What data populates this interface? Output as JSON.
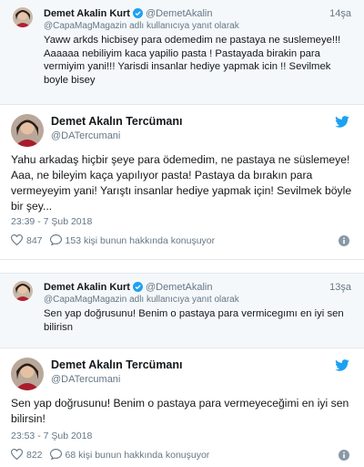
{
  "reply1": {
    "name": "Demet Akalin Kurt",
    "handle": "@DemetAkalin",
    "time": "14şa",
    "reply_to": "@CapaMagMagazin adlı kullanıcıya yanıt olarak",
    "text": "Yaww arkds hicbisey para odemedim ne pastaya ne suslemeye!!! Aaaaaa nebiliyim kaca yapilio pasta ! Pastayada birakin para vermiyim yani!!! Yarisdi insanlar hediye yapmak icin !! Sevilmek boyle bisey"
  },
  "card1": {
    "name": "Demet Akalın Tercümanı",
    "handle": "@DATercumani",
    "text": "Yahu arkadaş hiçbir şeye para ödemedim, ne pastaya ne süslemeye! Aaa, ne bileyim kaça yapılıyor pasta! Pastaya da bırakın para vermeyeyim yani! Yarıştı insanlar hediye yapmak için! Sevilmek böyle bir şey...",
    "date": "23:39 - 7 Şub 2018",
    "likes": "847",
    "talk": "153 kişi bunun hakkında konuşuyor"
  },
  "reply2": {
    "name": "Demet Akalin Kurt",
    "handle": "@DemetAkalin",
    "time": "13şa",
    "reply_to": "@CapaMagMagazin adlı kullanıcıya yanıt olarak",
    "text": "Sen yap doğrusunu! Benim  o pastaya para vermicegımı en iyi sen bilirisn"
  },
  "card2": {
    "name": "Demet Akalın Tercümanı",
    "handle": "@DATercumani",
    "text": "Sen yap doğrusunu! Benim o pastaya para vermeyeceğimi en iyi sen bilirsin!",
    "date": "23:53 - 7 Şub 2018",
    "likes": "822",
    "talk": "68 kişi bunun hakkında konuşuyor"
  },
  "colors": {
    "twitter_blue": "#1da1f2",
    "meta_gray": "#657786",
    "reply_bg": "#f5f8fa",
    "divider": "#e1e8ed"
  },
  "icons": [
    "verified-badge-icon",
    "twitter-bird-icon",
    "heart-icon",
    "speech-bubble-icon",
    "info-icon",
    "avatar"
  ]
}
